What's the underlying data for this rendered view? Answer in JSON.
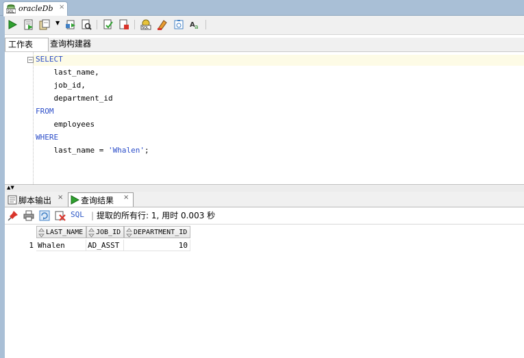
{
  "editor_tab": {
    "title": "oracleDb",
    "close": "×"
  },
  "toolbar": {
    "icons": [
      "run-statement-icon",
      "run-script-icon",
      "commit-icon",
      "dropdown-arrow-icon",
      "rollback-icon",
      "explain-plan-icon",
      "autotrace-icon",
      "sql-tuning-icon",
      "sql-history-icon",
      "clear-icon",
      "format-icon",
      "find-replace-icon"
    ]
  },
  "worksheet_tabs": [
    "工作表",
    "查询构建器"
  ],
  "sql": {
    "lines": [
      {
        "kw": "SELECT",
        "text": ""
      },
      {
        "kw": "",
        "text": "    last_name,"
      },
      {
        "kw": "",
        "text": "    job_id,"
      },
      {
        "kw": "",
        "text": "    department_id"
      },
      {
        "kw": "FROM",
        "text": ""
      },
      {
        "kw": "",
        "text": "    employees"
      },
      {
        "kw": "WHERE",
        "text": ""
      },
      {
        "kw": "",
        "text": "    last_name = ",
        "str": "'Whalen'",
        "tail": ";"
      }
    ]
  },
  "result_tabs": {
    "script_output": "脚本输出",
    "query_result": "查询结果",
    "close": "×"
  },
  "result_toolbar": {
    "sql_link": "SQL",
    "separator": "|",
    "fetched_text": "提取的所有行: 1, 用时 0.003 秒"
  },
  "grid": {
    "columns": [
      "LAST_NAME",
      "JOB_ID",
      "DEPARTMENT_ID"
    ],
    "rows": [
      {
        "num": "1",
        "last_name": "Whalen",
        "job_id": "AD_ASST",
        "department_id": "10"
      }
    ]
  },
  "colors": {
    "chrome_blue": "#a9bfd6",
    "keyword": "#2a4cc8",
    "current_line": "#fdfbe6"
  }
}
